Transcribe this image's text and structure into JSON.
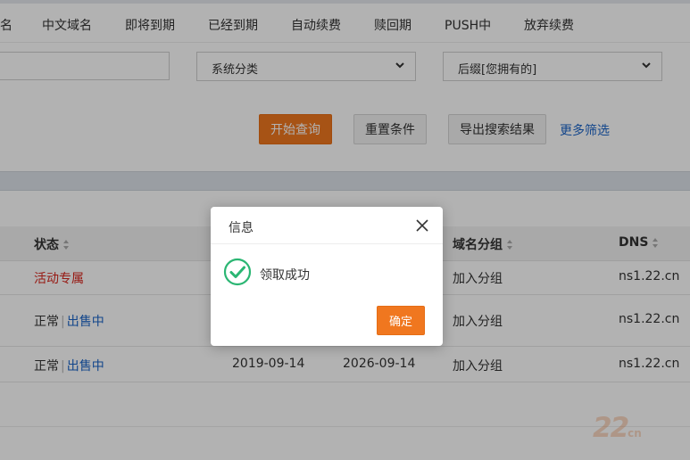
{
  "tabs": [
    {
      "label": "名"
    },
    {
      "label": "中文域名"
    },
    {
      "label": "即将到期"
    },
    {
      "label": "已经到期"
    },
    {
      "label": "自动续费"
    },
    {
      "label": "赎回期"
    },
    {
      "label": "PUSH中"
    },
    {
      "label": "放弃续费"
    }
  ],
  "filters": {
    "keyword_value": "",
    "category_select": "系统分类",
    "suffix_select": "后缀[您拥有的]"
  },
  "actions": {
    "search": "开始查询",
    "reset": "重置条件",
    "export": "导出搜索结果",
    "more_filters": "更多筛选"
  },
  "table": {
    "headers": {
      "status": "状态",
      "group": "域名分组",
      "dns": "DNS"
    },
    "rows": [
      {
        "status": "活动专属",
        "status_extra": "",
        "reg_date": "",
        "exp_date": "",
        "group": "加入分组",
        "dns": "ns1.22.cn"
      },
      {
        "status": "正常",
        "status_extra": "出售中",
        "reg_date": "",
        "exp_date": "",
        "group": "加入分组",
        "dns": "ns1.22.cn"
      },
      {
        "status": "正常",
        "status_extra": "出售中",
        "reg_date": "2019-09-14",
        "exp_date": "2026-09-14",
        "group": "加入分组",
        "dns": "ns1.22.cn"
      }
    ],
    "status_separator": "|"
  },
  "dialog": {
    "title": "信息",
    "message": "领取成功",
    "ok": "确定"
  },
  "watermark": {
    "main": "22",
    "suffix": "cn"
  },
  "colors": {
    "accent": "#f0771f",
    "link": "#1a64c8",
    "danger": "#d9251c",
    "success": "#2bb673"
  }
}
